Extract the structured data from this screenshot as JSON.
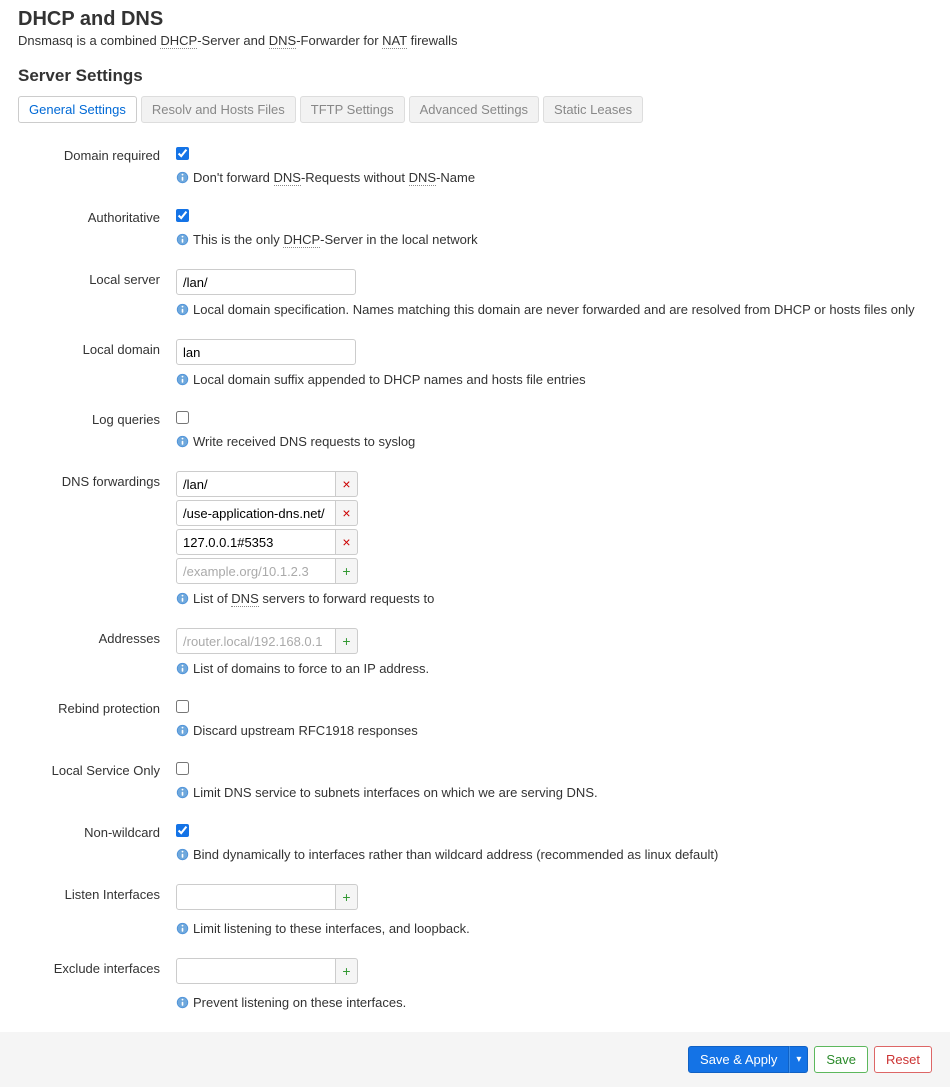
{
  "header": {
    "title": "DHCP and DNS",
    "description_parts": {
      "p1": "Dnsmasq is a combined ",
      "p2": "DHCP",
      "p3": "-Server and ",
      "p4": "DNS",
      "p5": "-Forwarder for ",
      "p6": "NAT",
      "p7": " firewalls"
    },
    "server_settings": "Server Settings"
  },
  "tabs": [
    {
      "id": "general",
      "label": "General Settings",
      "active": true
    },
    {
      "id": "resolv",
      "label": "Resolv and Hosts Files",
      "active": false
    },
    {
      "id": "tftp",
      "label": "TFTP Settings",
      "active": false
    },
    {
      "id": "advanced",
      "label": "Advanced Settings",
      "active": false
    },
    {
      "id": "leases",
      "label": "Static Leases",
      "active": false
    }
  ],
  "fields": {
    "domain_required": {
      "label": "Domain required",
      "checked": true,
      "hint_parts": {
        "p1": "Don't forward ",
        "p2": "DNS",
        "p3": "-Requests without ",
        "p4": "DNS",
        "p5": "-Name"
      }
    },
    "authoritative": {
      "label": "Authoritative",
      "checked": true,
      "hint_parts": {
        "p1": "This is the only ",
        "p2": "DHCP",
        "p3": "-Server in the local network"
      }
    },
    "local_server": {
      "label": "Local server",
      "value": "/lan/",
      "hint": "Local domain specification. Names matching this domain are never forwarded and are resolved from DHCP or hosts files only"
    },
    "local_domain": {
      "label": "Local domain",
      "value": "lan",
      "hint": "Local domain suffix appended to DHCP names and hosts file entries"
    },
    "log_queries": {
      "label": "Log queries",
      "checked": false,
      "hint": "Write received DNS requests to syslog"
    },
    "dns_forwardings": {
      "label": "DNS forwardings",
      "values": [
        "/lan/",
        "/use-application-dns.net/",
        "127.0.0.1#5353"
      ],
      "placeholder": "/example.org/10.1.2.3",
      "hint_parts": {
        "p1": "List of ",
        "p2": "DNS",
        "p3": " servers to forward requests to"
      }
    },
    "addresses": {
      "label": "Addresses",
      "placeholder": "/router.local/192.168.0.1",
      "hint": "List of domains to force to an IP address."
    },
    "rebind_protection": {
      "label": "Rebind protection",
      "checked": false,
      "hint": "Discard upstream RFC1918 responses"
    },
    "local_service_only": {
      "label": "Local Service Only",
      "checked": false,
      "hint": "Limit DNS service to subnets interfaces on which we are serving DNS."
    },
    "non_wildcard": {
      "label": "Non-wildcard",
      "checked": true,
      "hint": "Bind dynamically to interfaces rather than wildcard address (recommended as linux default)"
    },
    "listen_interfaces": {
      "label": "Listen Interfaces",
      "hint": "Limit listening to these interfaces, and loopback."
    },
    "exclude_interfaces": {
      "label": "Exclude interfaces",
      "hint": "Prevent listening on these interfaces."
    }
  },
  "footer": {
    "save_apply": "Save & Apply",
    "caret": "▾",
    "save": "Save",
    "reset": "Reset"
  },
  "glyphs": {
    "remove": "×",
    "add": "+"
  }
}
